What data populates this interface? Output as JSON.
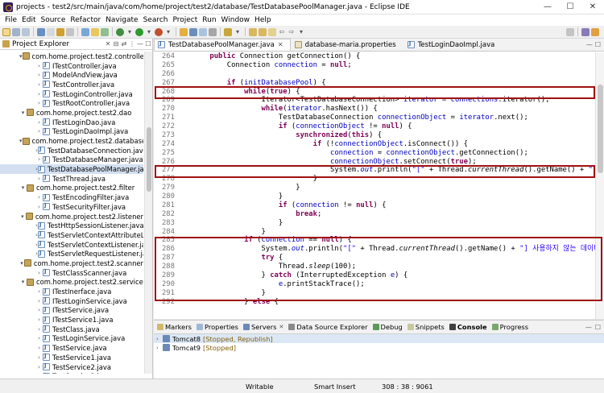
{
  "window": {
    "title": "projects - test2/src/main/java/com/home/project/test2/database/TestDatabasePoolManager.java - Eclipse IDE",
    "minimize": "—",
    "maximize": "☐",
    "close": "✕"
  },
  "menu": [
    "File",
    "Edit",
    "Source",
    "Refactor",
    "Navigate",
    "Search",
    "Project",
    "Run",
    "Window",
    "Help"
  ],
  "project_explorer": {
    "title": "Project Explorer",
    "items": [
      {
        "kind": "pkg",
        "label": "com.home.project.test2.controller"
      },
      {
        "kind": "file",
        "label": "ITestController.java"
      },
      {
        "kind": "file",
        "label": "ModelAndView.java"
      },
      {
        "kind": "file",
        "label": "TestController.java"
      },
      {
        "kind": "file",
        "label": "TestLoginController.java"
      },
      {
        "kind": "file",
        "label": "TestRootController.java"
      },
      {
        "kind": "pkg",
        "label": "com.home.project.test2.dao"
      },
      {
        "kind": "file",
        "label": "ITestLoginDao.java"
      },
      {
        "kind": "file",
        "label": "TestLoginDaoImpl.java"
      },
      {
        "kind": "pkg",
        "label": "com.home.project.test2.database"
      },
      {
        "kind": "file",
        "label": "TestDatabaseConnection.java"
      },
      {
        "kind": "file",
        "label": "TestDatabaseManager.java"
      },
      {
        "kind": "file",
        "label": "TestDatabasePoolManager.java",
        "selected": true
      },
      {
        "kind": "file",
        "label": "TestThread.java"
      },
      {
        "kind": "pkg",
        "label": "com.home.project.test2.filter"
      },
      {
        "kind": "file",
        "label": "TestEncodingFilter.java"
      },
      {
        "kind": "file",
        "label": "TestSecurityFilter.java"
      },
      {
        "kind": "pkg",
        "label": "com.home.project.test2.listener"
      },
      {
        "kind": "file",
        "label": "TestHttpSessionListener.java"
      },
      {
        "kind": "file",
        "label": "TestServletContextAttributeListe"
      },
      {
        "kind": "file",
        "label": "TestServletContextListener.java"
      },
      {
        "kind": "file",
        "label": "TestServletRequestListener.java"
      },
      {
        "kind": "pkg",
        "label": "com.home.project.test2.scanner"
      },
      {
        "kind": "file",
        "label": "TestClassScanner.java"
      },
      {
        "kind": "pkg",
        "label": "com.home.project.test2.service"
      },
      {
        "kind": "file",
        "label": "ITestInerface.java"
      },
      {
        "kind": "file",
        "label": "ITestLoginService.java"
      },
      {
        "kind": "file",
        "label": "ITestService.java"
      },
      {
        "kind": "file",
        "label": "ITestService1.java"
      },
      {
        "kind": "file",
        "label": "TestClass.java"
      },
      {
        "kind": "file",
        "label": "TestLoginService.java"
      },
      {
        "kind": "file",
        "label": "TestService.java"
      },
      {
        "kind": "file",
        "label": "TestService1.java"
      },
      {
        "kind": "file",
        "label": "TestService2.java"
      },
      {
        "kind": "file",
        "label": "TestService3.java"
      }
    ]
  },
  "editor": {
    "tabs": [
      {
        "label": "TestDatabasePoolManager.java",
        "active": true,
        "close": "✕"
      },
      {
        "label": "database-maria.properties",
        "active": false
      },
      {
        "label": "TestLoginDaoImpl.java",
        "active": false
      }
    ],
    "lines": [
      {
        "n": "264",
        "indent": 1,
        "segs": [
          [
            "kw",
            "public "
          ],
          [
            "",
            "Connection getConnection() {"
          ]
        ]
      },
      {
        "n": "265",
        "indent": 2,
        "segs": [
          [
            "",
            "Connection "
          ],
          [
            "fld",
            "connection"
          ],
          [
            "",
            " = "
          ],
          [
            "kw",
            "null"
          ],
          [
            "",
            ";"
          ]
        ]
      },
      {
        "n": "266",
        "indent": 0,
        "segs": [
          [
            "",
            ""
          ]
        ]
      },
      {
        "n": "267",
        "indent": 2,
        "segs": [
          [
            "kw",
            "if "
          ],
          [
            "",
            "("
          ],
          [
            "fld",
            "initDatabasePool"
          ],
          [
            "",
            ") {"
          ]
        ]
      },
      {
        "n": "268",
        "indent": 3,
        "segs": [
          [
            "kw",
            "while"
          ],
          [
            "",
            "("
          ],
          [
            "kw",
            "true"
          ],
          [
            "",
            ") {"
          ]
        ]
      },
      {
        "n": "269",
        "indent": 4,
        "segs": [
          [
            "",
            "Iterator<TestDatabaseConnection> "
          ],
          [
            "fld",
            "iterator"
          ],
          [
            "",
            " = "
          ],
          [
            "fld",
            "connections"
          ],
          [
            "",
            ".iterator();"
          ]
        ]
      },
      {
        "n": "270",
        "indent": 4,
        "segs": [
          [
            "kw",
            "while"
          ],
          [
            "",
            "("
          ],
          [
            "fld",
            "iterator"
          ],
          [
            "",
            ".hasNext()) {"
          ]
        ]
      },
      {
        "n": "271",
        "indent": 5,
        "segs": [
          [
            "",
            "TestDatabaseConnection "
          ],
          [
            "fld",
            "connectionObject"
          ],
          [
            "",
            " = "
          ],
          [
            "fld",
            "iterator"
          ],
          [
            "",
            ".next();"
          ]
        ]
      },
      {
        "n": "272",
        "indent": 5,
        "segs": [
          [
            "kw",
            "if "
          ],
          [
            "",
            "("
          ],
          [
            "fld",
            "connectionObject"
          ],
          [
            "",
            " != "
          ],
          [
            "kw",
            "null"
          ],
          [
            "",
            ") {"
          ]
        ]
      },
      {
        "n": "273",
        "indent": 6,
        "segs": [
          [
            "kw",
            "synchronized"
          ],
          [
            "",
            "("
          ],
          [
            "kw",
            "this"
          ],
          [
            "",
            ") {"
          ]
        ]
      },
      {
        "n": "274",
        "indent": 7,
        "segs": [
          [
            "kw",
            "if "
          ],
          [
            "",
            "(!"
          ],
          [
            "fld",
            "connectionObject"
          ],
          [
            "",
            ".isConnect()) {"
          ]
        ]
      },
      {
        "n": "275",
        "indent": 8,
        "segs": [
          [
            "fld",
            "connection"
          ],
          [
            "",
            " = "
          ],
          [
            "fld",
            "connectionObject"
          ],
          [
            "",
            ".getConnection();"
          ]
        ]
      },
      {
        "n": "276",
        "indent": 8,
        "segs": [
          [
            "fld",
            "connectionObject"
          ],
          [
            "",
            ".setConnect("
          ],
          [
            "kw",
            "true"
          ],
          [
            "",
            ");"
          ]
        ]
      },
      {
        "n": "277",
        "indent": 8,
        "segs": [
          [
            "",
            "System."
          ],
          [
            "fld it",
            "out"
          ],
          [
            "",
            ".println("
          ],
          [
            "str",
            "\"[\""
          ],
          [
            "",
            " + Thread."
          ],
          [
            "it",
            "currentThread"
          ],
          [
            "",
            "().getName() + "
          ],
          [
            "str",
            "\"] 데이터베이스"
          ]
        ]
      },
      {
        "n": "278",
        "indent": 7,
        "segs": [
          [
            "",
            "}"
          ]
        ]
      },
      {
        "n": "279",
        "indent": 6,
        "segs": [
          [
            "",
            "}"
          ]
        ]
      },
      {
        "n": "280",
        "indent": 5,
        "segs": [
          [
            "",
            "}"
          ]
        ]
      },
      {
        "n": "281",
        "indent": 5,
        "segs": [
          [
            "kw",
            "if "
          ],
          [
            "",
            "("
          ],
          [
            "fld",
            "connection"
          ],
          [
            "",
            " != "
          ],
          [
            "kw",
            "null"
          ],
          [
            "",
            ") {"
          ]
        ]
      },
      {
        "n": "282",
        "indent": 6,
        "segs": [
          [
            "kw",
            "break"
          ],
          [
            "",
            ";"
          ]
        ]
      },
      {
        "n": "283",
        "indent": 5,
        "segs": [
          [
            "",
            "}"
          ]
        ]
      },
      {
        "n": "284",
        "indent": 4,
        "segs": [
          [
            "",
            "}"
          ]
        ]
      },
      {
        "n": "285",
        "indent": 3,
        "segs": [
          [
            "kw",
            "if "
          ],
          [
            "",
            "("
          ],
          [
            "fld",
            "connection"
          ],
          [
            "",
            " == "
          ],
          [
            "kw",
            "null"
          ],
          [
            "",
            ") {"
          ]
        ]
      },
      {
        "n": "286",
        "indent": 4,
        "segs": [
          [
            "",
            "System."
          ],
          [
            "fld it",
            "out"
          ],
          [
            "",
            ".println("
          ],
          [
            "str",
            "\"[\""
          ],
          [
            "",
            " + Thread."
          ],
          [
            "it",
            "currentThread"
          ],
          [
            "",
            "().getName() + "
          ],
          [
            "str",
            "\"] 사용하지 않는 데이터베이스 커"
          ]
        ]
      },
      {
        "n": "287",
        "indent": 4,
        "segs": [
          [
            "kw",
            "try "
          ],
          [
            "",
            "{"
          ]
        ]
      },
      {
        "n": "288",
        "indent": 5,
        "segs": [
          [
            "",
            "Thread."
          ],
          [
            "it",
            "sleep"
          ],
          [
            "",
            "(100);"
          ]
        ]
      },
      {
        "n": "289",
        "indent": 4,
        "segs": [
          [
            "",
            "} "
          ],
          [
            "kw",
            "catch "
          ],
          [
            "",
            "(InterruptedException "
          ],
          [
            "fld",
            "e"
          ],
          [
            "",
            ") {"
          ]
        ]
      },
      {
        "n": "290",
        "indent": 5,
        "segs": [
          [
            "fld",
            "e"
          ],
          [
            "",
            ".printStackTrace();"
          ]
        ]
      },
      {
        "n": "291",
        "indent": 4,
        "segs": [
          [
            "",
            "}"
          ]
        ]
      },
      {
        "n": "292",
        "indent": 3,
        "segs": [
          [
            "",
            "} "
          ],
          [
            "kw",
            "else "
          ],
          [
            "",
            "{"
          ]
        ]
      }
    ]
  },
  "bottom": {
    "tabs": [
      {
        "label": "Markers",
        "active": false
      },
      {
        "label": "Properties",
        "active": false
      },
      {
        "label": "Servers",
        "active": false,
        "close": "✕"
      },
      {
        "label": "Data Source Explorer",
        "active": false
      },
      {
        "label": "Debug",
        "active": false
      },
      {
        "label": "Snippets",
        "active": false
      },
      {
        "label": "Console",
        "active": true
      },
      {
        "label": "Progress",
        "active": false
      }
    ],
    "servers": [
      {
        "name": "Tomcat8",
        "status": "[Stopped, Republish]",
        "selected": true
      },
      {
        "name": "Tomcat9",
        "status": "[Stopped]",
        "selected": false
      }
    ]
  },
  "status_bar": {
    "writable": "Writable",
    "insert_mode": "Smart Insert",
    "position": "308 : 38 : 9061"
  },
  "colors": {
    "highlight_box": "#a01010",
    "keyword": "#7f0055",
    "field": "#0000c0",
    "string": "#2a00ff",
    "selection": "#d3dff0"
  }
}
